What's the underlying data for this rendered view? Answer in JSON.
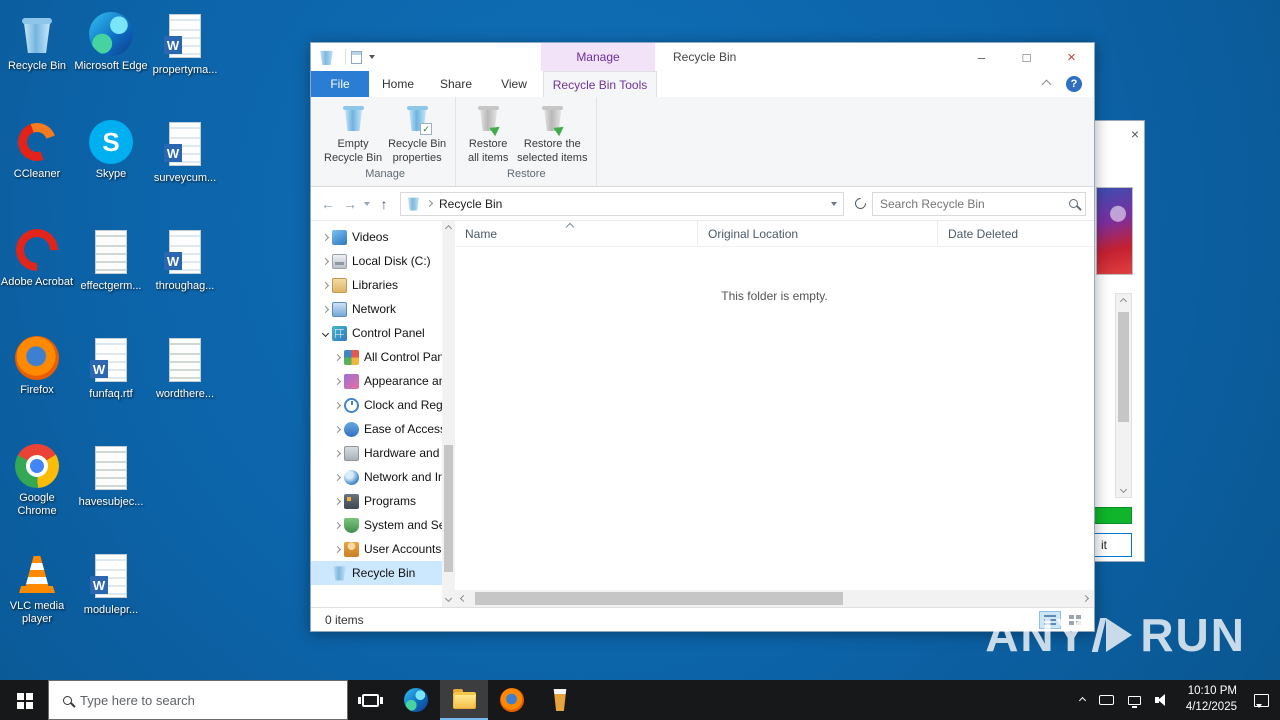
{
  "watermark": {
    "left": "ANY",
    "right": "RUN"
  },
  "desktop": {
    "columns": [
      {
        "items": [
          {
            "label": "Recycle Bin",
            "icon": "recycle-bin-icon"
          },
          {
            "label": "CCleaner",
            "icon": "ccleaner-icon"
          },
          {
            "label": "Adobe Acrobat",
            "icon": "acrobat-icon"
          },
          {
            "label": "Firefox",
            "icon": "firefox-icon"
          },
          {
            "label": "Google Chrome",
            "icon": "chrome-icon"
          },
          {
            "label": "VLC media player",
            "icon": "vlc-icon"
          }
        ]
      },
      {
        "items": [
          {
            "label": "Microsoft Edge",
            "icon": "edge-icon"
          },
          {
            "label": "Skype",
            "icon": "skype-icon"
          },
          {
            "label": "effectgerm...",
            "icon": "text-file-icon"
          },
          {
            "label": "funfaq.rtf",
            "icon": "word-file-icon"
          },
          {
            "label": "havesubjec...",
            "icon": "text-file-icon"
          },
          {
            "label": "modulepr...",
            "icon": "word-file-icon"
          }
        ]
      },
      {
        "items": [
          {
            "label": "propertyma...",
            "icon": "word-file-icon"
          },
          {
            "label": "surveycum...",
            "icon": "word-file-icon"
          },
          {
            "label": "throughag...",
            "icon": "word-file-icon"
          },
          {
            "label": "wordthere...",
            "icon": "text-file-icon"
          }
        ]
      }
    ]
  },
  "explorer": {
    "title": "Recycle Bin",
    "contextual_group": "Manage",
    "tabs": {
      "file": "File",
      "home": "Home",
      "share": "Share",
      "view": "View",
      "tool": "Recycle Bin Tools"
    },
    "window_controls": {
      "minimize": "–",
      "maximize": "□",
      "close": "×"
    },
    "ribbon": {
      "buttons": [
        {
          "line1": "Empty",
          "line2": "Recycle Bin",
          "icon": "empty-recycle-bin-icon"
        },
        {
          "line1": "Recycle Bin",
          "line2": "properties",
          "icon": "recycle-bin-properties-icon"
        },
        {
          "line1": "Restore",
          "line2": "all items",
          "icon": "restore-all-items-icon"
        },
        {
          "line1": "Restore the",
          "line2": "selected items",
          "icon": "restore-selected-items-icon"
        }
      ],
      "groups": [
        "Manage",
        "Restore"
      ]
    },
    "address": {
      "location": "Recycle Bin"
    },
    "search_placeholder": "Search Recycle Bin",
    "tree": [
      {
        "label": "Videos",
        "icon": "videos-icon"
      },
      {
        "label": "Local Disk (C:)",
        "icon": "disk-icon"
      },
      {
        "label": "Libraries",
        "icon": "libraries-icon"
      },
      {
        "label": "Network",
        "icon": "network-icon"
      },
      {
        "label": "Control Panel",
        "icon": "control-panel-icon"
      },
      {
        "label": "All Control Pan",
        "icon": "all-control-panel-items-icon"
      },
      {
        "label": "Appearance an",
        "icon": "appearance-icon"
      },
      {
        "label": "Clock and Regi",
        "icon": "clock-region-icon"
      },
      {
        "label": "Ease of Access",
        "icon": "ease-of-access-icon"
      },
      {
        "label": "Hardware and",
        "icon": "hardware-icon"
      },
      {
        "label": "Network and In",
        "icon": "network-internet-icon"
      },
      {
        "label": "Programs",
        "icon": "programs-icon"
      },
      {
        "label": "System and Se",
        "icon": "system-security-icon"
      },
      {
        "label": "User Accounts",
        "icon": "user-accounts-icon"
      },
      {
        "label": "Recycle Bin",
        "icon": "recycle-bin-icon"
      }
    ],
    "columns": [
      "Name",
      "Original Location",
      "Date Deleted"
    ],
    "empty_message": "This folder is empty.",
    "status": "0 items"
  },
  "background_window": {
    "button_label": "it"
  },
  "taskbar": {
    "search_placeholder": "Type here to search",
    "clock": {
      "time": "10:10 PM",
      "date": "4/12/2025"
    }
  }
}
